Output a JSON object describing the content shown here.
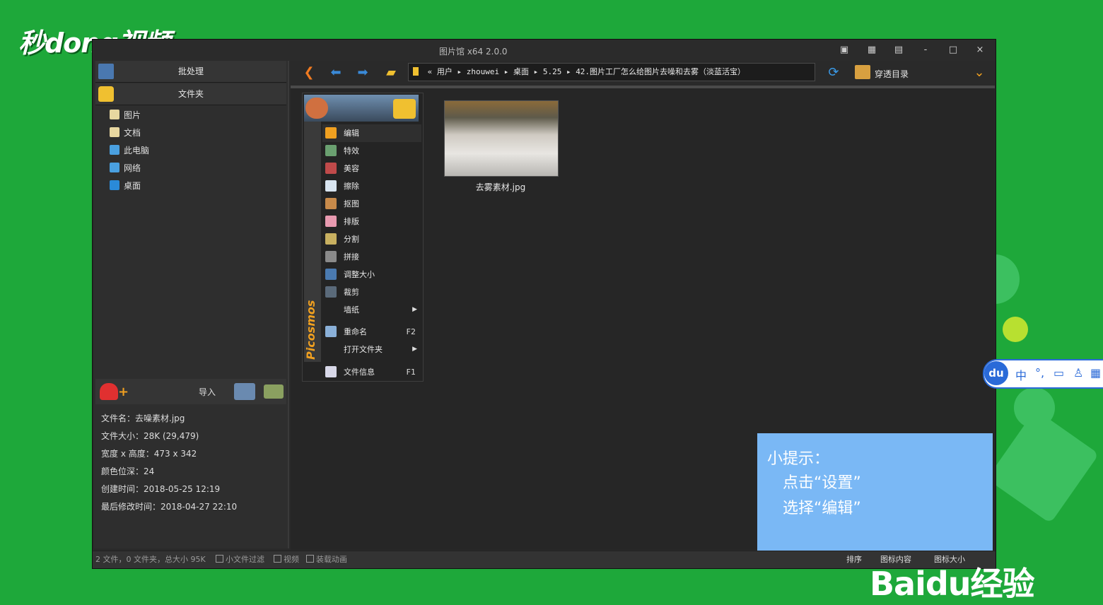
{
  "watermark": {
    "logo_text": "秒dong视频",
    "baidu_text": "Baidu经验"
  },
  "window": {
    "title": "图片馆 x64 2.0.0",
    "buttons": {
      "minimize": "-",
      "maximize": "□",
      "close": "×"
    }
  },
  "sidebar": {
    "batch_label": "批处理",
    "folder_label": "文件夹",
    "tree": [
      {
        "label": "图片",
        "icon": "pictures-icon",
        "color": "#e8d7a0"
      },
      {
        "label": "文档",
        "icon": "documents-icon",
        "color": "#e8d7a0"
      },
      {
        "label": "此电脑",
        "icon": "computer-icon",
        "color": "#4aa0e0"
      },
      {
        "label": "网络",
        "icon": "network-icon",
        "color": "#4aa0e0"
      },
      {
        "label": "桌面",
        "icon": "desktop-icon",
        "color": "#2a8ad8"
      }
    ],
    "import_label": "导入"
  },
  "file_info": [
    "文件名：去噪素材.jpg",
    "文件大小：28K (29,479)",
    "宽度 x 高度：473 x 342",
    "颜色位深：24",
    "创建时间：2018-05-25 12:19",
    "最后修改时间：2018-04-27 22:10"
  ],
  "toolbar": {
    "address": "« 用户 ▸ zhouwei ▸ 桌面 ▸ 5.25 ▸ 42.图片工厂怎么给图片去噪和去雾（淡蓝活宝）",
    "pass_through_label": "穿透目录"
  },
  "context_menu": {
    "brand": "Picosmos",
    "items": [
      {
        "label": "编辑",
        "key": "",
        "submenu": false,
        "icon": "edit-icon",
        "color": "#f0a020"
      },
      {
        "label": "特效",
        "key": "",
        "submenu": false,
        "icon": "effects-icon",
        "color": "#6aa070"
      },
      {
        "label": "美容",
        "key": "",
        "submenu": false,
        "icon": "beauty-icon",
        "color": "#c04a4a"
      },
      {
        "label": "擦除",
        "key": "",
        "submenu": false,
        "icon": "erase-icon",
        "color": "#d8e4f0"
      },
      {
        "label": "抠图",
        "key": "",
        "submenu": false,
        "icon": "cutout-icon",
        "color": "#c88a4a"
      },
      {
        "label": "排版",
        "key": "",
        "submenu": false,
        "icon": "layout-icon",
        "color": "#e89ab0"
      },
      {
        "label": "分割",
        "key": "",
        "submenu": false,
        "icon": "split-icon",
        "color": "#c8b060"
      },
      {
        "label": "拼接",
        "key": "",
        "submenu": false,
        "icon": "stitch-icon",
        "color": "#8a8a8a"
      },
      {
        "label": "调整大小",
        "key": "",
        "submenu": false,
        "icon": "resize-icon",
        "color": "#4a7ab0"
      },
      {
        "label": "裁剪",
        "key": "",
        "submenu": false,
        "icon": "crop-icon",
        "color": "#5a6a7a"
      },
      {
        "label": "墙纸",
        "key": "",
        "submenu": true,
        "icon": "",
        "color": ""
      },
      {
        "label": "重命名",
        "key": "F2",
        "submenu": false,
        "icon": "rename-icon",
        "color": "#8ab0d8"
      },
      {
        "label": "打开文件夹",
        "key": "",
        "submenu": true,
        "icon": "",
        "color": ""
      },
      {
        "label": "文件信息",
        "key": "F1",
        "submenu": false,
        "icon": "file-info-icon",
        "color": "#d8d8e8"
      }
    ]
  },
  "thumbnail": {
    "filename": "去雾素材.jpg"
  },
  "tip": {
    "title": "小提示：",
    "line1": "点击“设置”",
    "line2": "选择“编辑”"
  },
  "statusbar": {
    "summary": "2 文件，0 文件夹，总大小 95K",
    "small_file_filter": "小文件过滤",
    "video": "视频",
    "load_animation": "装载动画",
    "sort": "排序",
    "icon_content": "图标内容",
    "icon_size": "图标大小"
  },
  "ime": {
    "logo": "du",
    "mode": "中"
  }
}
